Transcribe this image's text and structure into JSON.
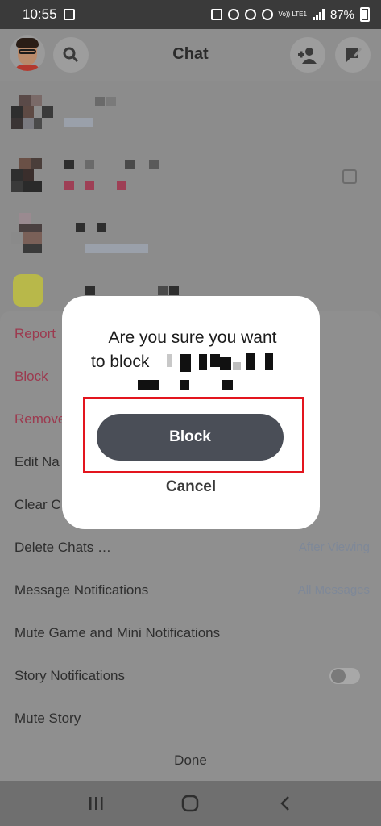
{
  "status_bar": {
    "time": "10:55",
    "battery": "87%",
    "network": "Vo)) LTE1"
  },
  "header": {
    "title": "Chat"
  },
  "menu": {
    "items": [
      {
        "label": "Report",
        "style": "danger"
      },
      {
        "label": "Block",
        "style": "danger"
      },
      {
        "label": "Remove",
        "style": "danger"
      },
      {
        "label": "Edit Na",
        "style": "normal"
      },
      {
        "label": "Clear C",
        "style": "normal"
      },
      {
        "label": "Delete Chats …",
        "style": "normal",
        "value": "After Viewing"
      },
      {
        "label": "Message Notifications",
        "style": "normal",
        "value": "All Messages"
      },
      {
        "label": "Mute Game and Mini Notifications",
        "style": "normal"
      },
      {
        "label": "Story Notifications",
        "style": "normal",
        "toggle": false
      },
      {
        "label": "Mute Story",
        "style": "normal"
      }
    ],
    "done_label": "Done"
  },
  "dialog": {
    "title_line1": "Are you sure you want",
    "title_line2": "to block",
    "primary_label": "Block",
    "secondary_label": "Cancel"
  },
  "colors": {
    "danger_text": "#9c3a4f",
    "primary_button": "#4a4e57",
    "highlight": "#e3151e"
  }
}
